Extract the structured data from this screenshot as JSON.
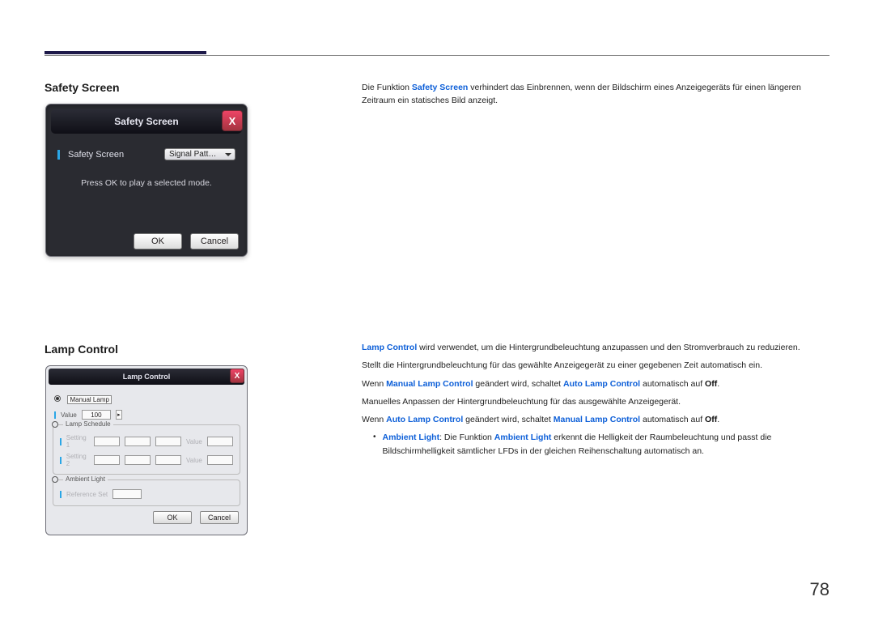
{
  "page_number": "78",
  "sections": {
    "safety": {
      "heading": "Safety Screen",
      "paragraph_a": "Die Funktion ",
      "em": "Safety Screen",
      "paragraph_b": " verhindert das Einbrennen, wenn der Bildschirm eines Anzeigegeräts für einen längeren Zeitraum ein statisches Bild anzeigt.",
      "dialog": {
        "title": "Safety Screen",
        "option_label": "Safety Screen",
        "combo_value": "Signal Patt…",
        "hint": "Press OK to play a selected mode.",
        "ok": "OK",
        "cancel": "Cancel"
      }
    },
    "lamp": {
      "heading": "Lamp Control",
      "p1_a": "Lamp Control",
      "p1_b": " wird verwendet, um die Hintergrundbeleuchtung anzupassen und den Stromverbrauch zu reduzieren.",
      "p2": "Stellt die Hintergrundbeleuchtung für das gewählte Anzeigegerät zu einer gegebenen Zeit automatisch ein.",
      "p3_a": "Wenn ",
      "p3_b": "Manual Lamp Control",
      "p3_c": " geändert wird, schaltet ",
      "p3_d": "Auto Lamp Control",
      "p3_e": " automatisch auf ",
      "p3_f": "Off",
      "p3_g": ".",
      "p4": "Manuelles Anpassen der Hintergrundbeleuchtung für das ausgewählte Anzeigegerät.",
      "p5_a": "Wenn ",
      "p5_b": "Auto Lamp Control",
      "p5_c": " geändert wird, schaltet ",
      "p5_d": "Manual Lamp Control",
      "p5_e": " automatisch auf ",
      "p5_f": "Off",
      "p5_g": ".",
      "bullet_a": "Ambient Light",
      "bullet_b": ": Die Funktion ",
      "bullet_c": "Ambient Light",
      "bullet_d": " erkennt die Helligkeit der Raumbeleuchtung und passt die Bildschirmhelligkeit sämtlicher LFDs in der gleichen Reihenschaltung automatisch an.",
      "dialog": {
        "title": "Lamp Control",
        "manual_lamp": "Manual Lamp",
        "value_label": "Value",
        "value": "100",
        "lamp_schedule": "Lamp Schedule",
        "setting1": "Setting 1",
        "setting2": "Setting 2",
        "val_lbl": "Value",
        "ambient_light": "Ambient Light",
        "ref_set": "Reference Set",
        "ok": "OK",
        "cancel": "Cancel"
      }
    }
  }
}
